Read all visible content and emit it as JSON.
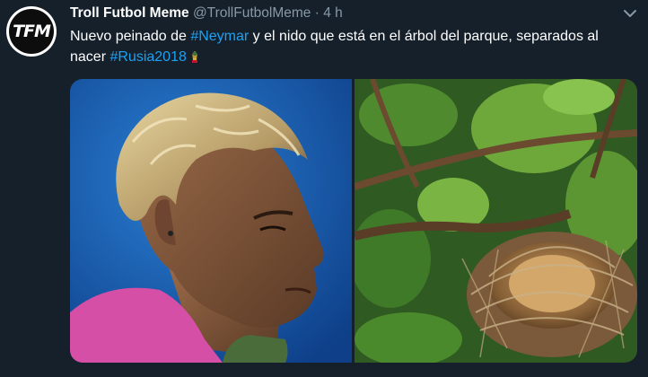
{
  "tweet": {
    "display_name": "Troll Futbol Meme",
    "handle": "@TrollFutbolMeme",
    "separator": "·",
    "time": "4 h",
    "avatar_text": "TFM",
    "text_1": "Nuevo peinado de ",
    "hashtag_1": "#Neymar",
    "text_2": " y el nido que está en el árbol del parque, separados al nacer ",
    "hashtag_2": "#Rusia2018",
    "emoji_icon": "world-cup-trophy-icon",
    "menu_icon": "chevron-down-icon"
  },
  "media": {
    "count": 2
  },
  "colors": {
    "background": "#15202b",
    "text": "#ffffff",
    "secondary": "#8899a6",
    "link": "#1da1f2"
  }
}
